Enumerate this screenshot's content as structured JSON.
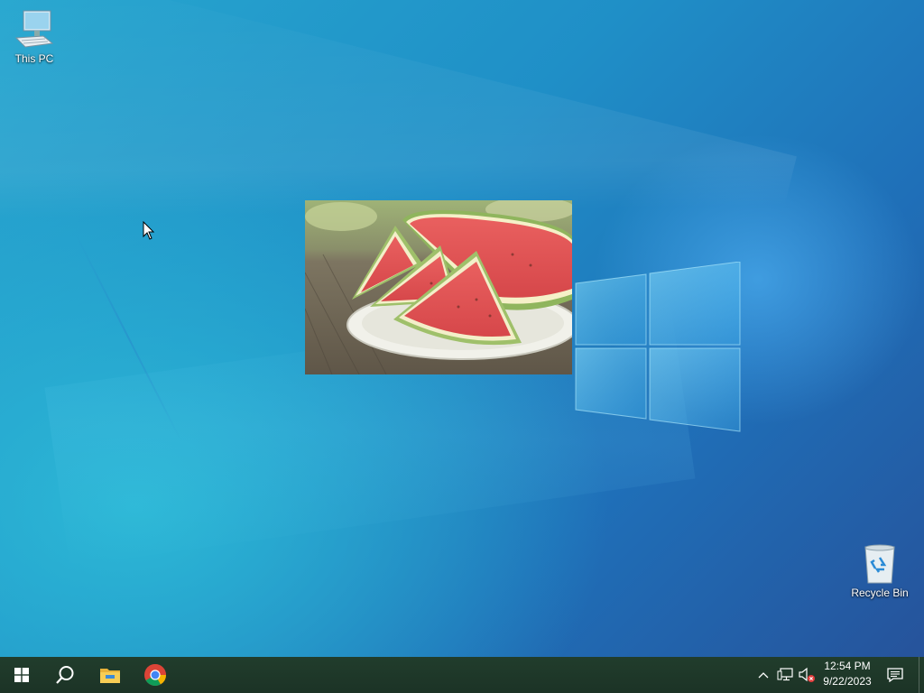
{
  "desktop": {
    "icons": [
      {
        "label": "This PC",
        "icon": "computer-icon"
      },
      {
        "label": "Recycle Bin",
        "icon": "recycle-bin-icon"
      }
    ],
    "wallpaper": {
      "style": "Windows 10 default blue hero",
      "accent": "#1f8fc7"
    },
    "photo": {
      "subject": "watermelon-slices-photo"
    }
  },
  "taskbar": {
    "background": "#1f3a2a",
    "items": [
      {
        "icon": "windows-start-icon"
      },
      {
        "icon": "search-icon"
      },
      {
        "icon": "file-explorer-icon"
      },
      {
        "icon": "chrome-icon"
      }
    ],
    "tray": {
      "icons": [
        "chevron-up-icon",
        "network-icon",
        "volume-muted-icon"
      ],
      "time": "12:54 PM",
      "date": "9/22/2023",
      "notification_icon": "action-center-icon"
    }
  }
}
